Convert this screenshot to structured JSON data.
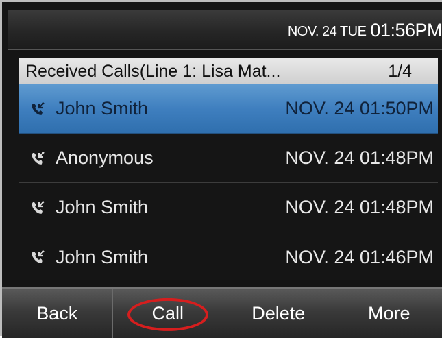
{
  "status_bar": {
    "date": "NOV. 24 TUE",
    "time": "01:56PM"
  },
  "list": {
    "title": "Received Calls(Line 1: Lisa Mat...",
    "page": "1/4",
    "rows": [
      {
        "name": "John Smith",
        "time": "NOV. 24 01:50PM",
        "icon": "received-call-icon",
        "selected": true
      },
      {
        "name": "Anonymous",
        "time": "NOV. 24 01:48PM",
        "icon": "received-call-icon",
        "selected": false
      },
      {
        "name": "John Smith",
        "time": "NOV. 24 01:48PM",
        "icon": "received-call-icon",
        "selected": false
      },
      {
        "name": "John Smith",
        "time": "NOV. 24 01:46PM",
        "icon": "received-call-icon",
        "selected": false
      }
    ]
  },
  "softkeys": {
    "back": "Back",
    "call": "Call",
    "delete": "Delete",
    "more": "More"
  },
  "colors": {
    "selected_row": "#3f7fbf",
    "annotation_ring": "#d61e1e"
  }
}
